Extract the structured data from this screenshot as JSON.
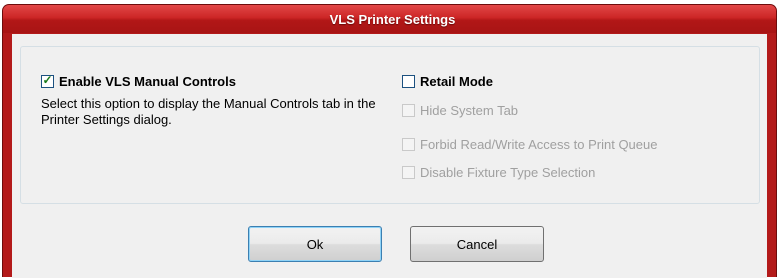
{
  "window": {
    "title": "VLS Printer Settings"
  },
  "options": {
    "enable_manual_controls": {
      "label": "Enable VLS Manual Controls",
      "checked": true,
      "description": "Select this option to display the Manual Controls tab in the Printer Settings dialog."
    },
    "retail_mode": {
      "label": "Retail Mode",
      "checked": false
    },
    "hide_system_tab": {
      "label": "Hide System Tab",
      "checked": false,
      "enabled": false
    },
    "forbid_read_write": {
      "label": "Forbid Read/Write Access to Print Queue",
      "checked": false,
      "enabled": false
    },
    "disable_fixture_type": {
      "label": "Disable Fixture Type Selection",
      "checked": false,
      "enabled": false
    }
  },
  "buttons": {
    "ok_label": "Ok",
    "cancel_label": "Cancel"
  },
  "colors": {
    "title_bar": "#c41f1f",
    "dialog_face": "#f0f0f0",
    "disabled_text": "#a0a0a0",
    "checkmark": "#1a7a1a"
  }
}
